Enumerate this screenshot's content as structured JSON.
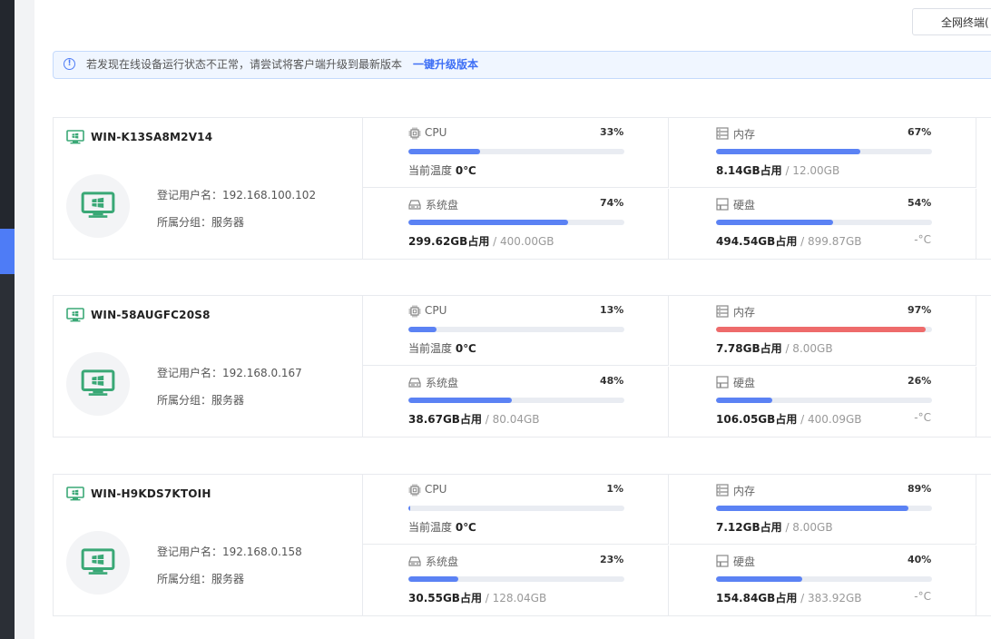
{
  "toolbar": {
    "all_terminals_label": "全网终端("
  },
  "notice": {
    "message": "若发现在线设备运行状态不正常，请尝试将客户端升级到最新版本",
    "action": "一键升级版本"
  },
  "labels": {
    "cpu": "CPU",
    "memory": "内存",
    "system_disk": "系统盘",
    "disk": "硬盘",
    "temperature_prefix": "当前温度",
    "used_suffix": "占用",
    "registered_user_prefix": "登记用户名：",
    "group_prefix": "所属分组："
  },
  "colors": {
    "accent": "#4e7cf6",
    "bar_normal": "#5b82f4",
    "bar_warning": "#ee6b6b",
    "icon_green": "#3aa876"
  },
  "devices": [
    {
      "name": "WIN-K13SA8M2V14",
      "ip": "192.168.100.102",
      "group": "服务器",
      "cpu": {
        "percent_text": "33%",
        "percent": 33,
        "temperature": "0℃"
      },
      "memory": {
        "percent_text": "67%",
        "percent": 67,
        "used": "8.14GB",
        "total": "/ 12.00GB"
      },
      "system_disk": {
        "percent_text": "74%",
        "percent": 74,
        "used": "299.62GB",
        "total": "/ 400.00GB"
      },
      "disk": {
        "percent_text": "54%",
        "percent": 54,
        "used": "494.54GB",
        "total": "/ 899.87GB",
        "temperature": "-°C"
      }
    },
    {
      "name": "WIN-58AUGFC20S8",
      "ip": "192.168.0.167",
      "group": "服务器",
      "cpu": {
        "percent_text": "13%",
        "percent": 13,
        "temperature": "0℃"
      },
      "memory": {
        "percent_text": "97%",
        "percent": 97,
        "used": "7.78GB",
        "total": "/ 8.00GB",
        "warning": true
      },
      "system_disk": {
        "percent_text": "48%",
        "percent": 48,
        "used": "38.67GB",
        "total": "/ 80.04GB"
      },
      "disk": {
        "percent_text": "26%",
        "percent": 26,
        "used": "106.05GB",
        "total": "/ 400.09GB",
        "temperature": "-°C"
      }
    },
    {
      "name": "WIN-H9KDS7KTOIH",
      "ip": "192.168.0.158",
      "group": "服务器",
      "cpu": {
        "percent_text": "1%",
        "percent": 1,
        "temperature": "0℃"
      },
      "memory": {
        "percent_text": "89%",
        "percent": 89,
        "used": "7.12GB",
        "total": "/ 8.00GB"
      },
      "system_disk": {
        "percent_text": "23%",
        "percent": 23,
        "used": "30.55GB",
        "total": "/ 128.04GB"
      },
      "disk": {
        "percent_text": "40%",
        "percent": 40,
        "used": "154.84GB",
        "total": "/ 383.92GB",
        "temperature": "-°C"
      }
    }
  ]
}
